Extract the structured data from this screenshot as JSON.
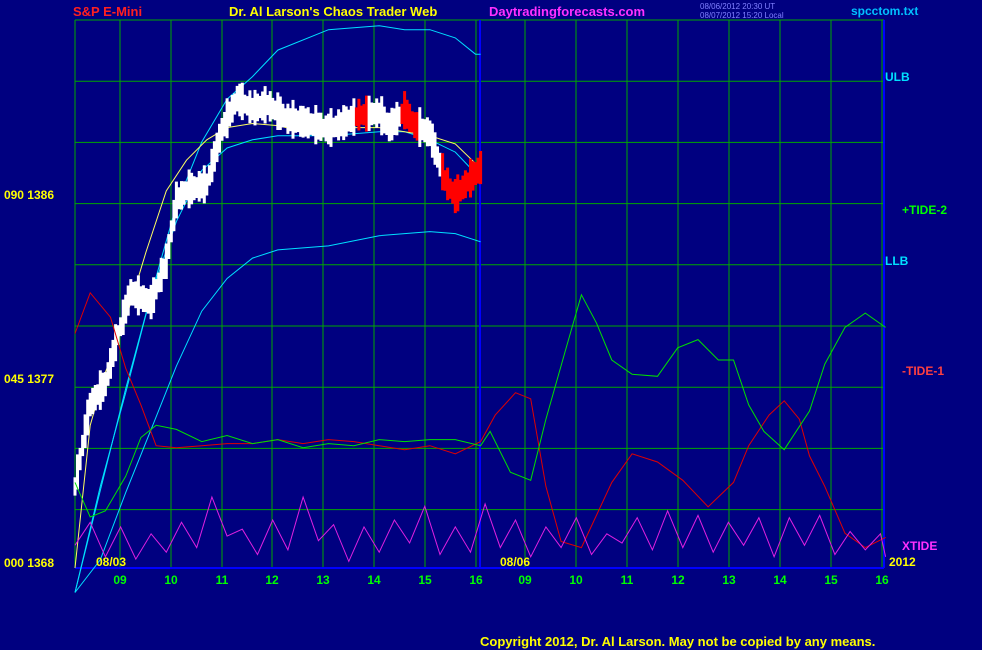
{
  "header": {
    "instrument": "S&P E-Mini",
    "title": "Dr. Al Larson's Chaos Trader Web",
    "site": "Daytradingforecasts.com",
    "stamp1": "08/06/2012 20:30 UT",
    "stamp2": "08/07/2012 15:20 Local",
    "file": "spcctom.txt"
  },
  "footer": {
    "copyright": "Copyright 2012, Dr. Al Larson. May not be copied by any means."
  },
  "colors": {
    "background": "#000080",
    "grid": "#00a800",
    "price_bars": "#ffffff",
    "down_bars": "#ff0000",
    "bands": "#00e0ff",
    "tide1": "#e00000",
    "tide2": "#00e000",
    "xtide": "#e020e0",
    "date_labels": "#ffff00",
    "hour_labels": "#00ff00"
  },
  "chart_data": {
    "type": "line",
    "title": "S&P E-Mini",
    "y_axis": {
      "labels": [
        {
          "osc": "090",
          "price": 1386
        },
        {
          "osc": "045",
          "price": 1377
        },
        {
          "osc": "000",
          "price": 1368
        }
      ],
      "ylim": [
        1368,
        1395
      ]
    },
    "x_axis": {
      "hours": [
        "09",
        "10",
        "11",
        "12",
        "13",
        "14",
        "15",
        "16",
        "09",
        "10",
        "11",
        "12",
        "13",
        "14",
        "15",
        "16"
      ],
      "dates": [
        "08/03",
        "08/06"
      ],
      "year": "2012"
    },
    "right_labels": [
      "ULB",
      "+TIDE-2",
      "LLB",
      "-TIDE-1",
      "XTIDE"
    ],
    "grid": true,
    "series": [
      {
        "name": "ULB",
        "x": [
          0.0,
          0.5,
          1.0,
          1.5,
          2.0,
          2.5,
          3.0,
          3.5,
          4.0,
          5.0,
          6.0,
          6.5,
          7.0,
          7.5,
          7.9,
          8.0
        ],
        "y": [
          1366.8,
          1371.8,
          1376.8,
          1381.4,
          1385.8,
          1388.9,
          1391.0,
          1392.1,
          1393.4,
          1394.4,
          1394.6,
          1394.4,
          1394.4,
          1394.0,
          1393.2,
          1393.2
        ]
      },
      {
        "name": "LLB",
        "x": [
          0.0,
          0.5,
          1.0,
          1.5,
          2.0,
          2.5,
          3.0,
          3.5,
          4.0,
          5.0,
          6.0,
          6.5,
          7.0,
          7.5,
          8.0
        ],
        "y": [
          1366.8,
          1368.4,
          1371.7,
          1374.8,
          1377.9,
          1380.6,
          1382.2,
          1383.2,
          1383.6,
          1383.8,
          1384.3,
          1384.4,
          1384.5,
          1384.4,
          1384.0
        ]
      },
      {
        "name": "MID",
        "x": [
          0.0,
          0.5,
          1.0,
          1.5,
          2.0,
          2.5,
          3.0,
          3.5,
          4.0,
          5.0,
          6.0,
          6.5,
          7.0,
          7.5,
          8.0
        ],
        "y": [
          1366.8,
          1372.0,
          1376.6,
          1381.4,
          1385.0,
          1387.5,
          1388.6,
          1389.0,
          1389.2,
          1389.2,
          1389.4,
          1389.4,
          1389.0,
          1388.4,
          1387.1
        ]
      },
      {
        "name": "MA",
        "x": [
          0.0,
          0.3,
          0.6,
          1.0,
          1.4,
          1.8,
          2.2,
          2.6,
          3.0,
          3.5,
          4.0,
          4.5,
          5.0,
          5.5,
          6.0,
          6.5,
          7.0,
          7.5,
          8.0
        ],
        "y": [
          1368.0,
          1375.0,
          1377.6,
          1380.2,
          1383.5,
          1386.5,
          1388.0,
          1389.0,
          1389.6,
          1389.8,
          1389.7,
          1389.4,
          1389.4,
          1389.6,
          1389.6,
          1389.4,
          1389.2,
          1388.8,
          1387.6
        ]
      },
      {
        "name": "TIDE-1",
        "x": [
          0.0,
          0.3,
          0.7,
          1.0,
          1.3,
          1.6,
          2.0,
          2.5,
          3.0,
          3.5,
          4.0,
          4.5,
          5.0,
          5.5,
          6.0,
          6.5,
          7.0,
          7.5,
          8.0,
          8.3,
          8.7,
          9.0,
          9.3,
          9.6,
          10.0,
          10.3,
          10.6,
          11.0,
          11.5,
          12.0,
          12.5,
          13.0,
          13.3,
          13.7,
          14.0,
          14.3,
          14.5,
          14.8,
          15.2,
          15.6,
          16.0
        ],
        "y": [
          115,
          135,
          123,
          98,
          80,
          60,
          59,
          60,
          61,
          61,
          63,
          61,
          63,
          62,
          60,
          58,
          60,
          56,
          62,
          75,
          86,
          83,
          40,
          13,
          10,
          26,
          42,
          56,
          52,
          43,
          30,
          42,
          60,
          75,
          82,
          73,
          55,
          40,
          17,
          10,
          15
        ]
      },
      {
        "name": "TIDE-2",
        "x": [
          0.0,
          0.3,
          0.6,
          1.0,
          1.3,
          1.6,
          2.0,
          2.5,
          3.0,
          3.5,
          4.0,
          4.5,
          5.0,
          5.5,
          6.0,
          6.5,
          7.0,
          7.5,
          8.0,
          8.2,
          8.6,
          9.0,
          9.3,
          9.7,
          10.0,
          10.3,
          10.6,
          11.0,
          11.5,
          11.9,
          12.3,
          12.7,
          13.0,
          13.3,
          13.6,
          14.0,
          14.5,
          14.8,
          15.2,
          15.6,
          16.0
        ],
        "y": [
          42,
          25,
          28,
          45,
          64,
          70,
          68,
          62,
          65,
          61,
          63,
          59,
          61,
          60,
          63,
          62,
          63,
          63,
          60,
          67,
          47,
          43,
          73,
          108,
          134,
          120,
          102,
          95,
          94,
          108,
          112,
          102,
          102,
          80,
          67,
          58,
          77,
          100,
          118,
          125,
          118
        ]
      },
      {
        "name": "XTIDE",
        "x": [
          0.0,
          0.3,
          0.6,
          0.9,
          1.2,
          1.5,
          1.8,
          2.1,
          2.4,
          2.7,
          3.0,
          3.3,
          3.6,
          3.9,
          4.2,
          4.5,
          4.8,
          5.1,
          5.4,
          5.7,
          6.0,
          6.3,
          6.6,
          6.9,
          7.2,
          7.5,
          7.8,
          8.1,
          8.4,
          8.7,
          9.0,
          9.3,
          9.6,
          9.9,
          10.2,
          10.5,
          10.8,
          11.1,
          11.4,
          11.7,
          12.0,
          12.3,
          12.6,
          12.9,
          13.2,
          13.5,
          13.8,
          14.1,
          14.4,
          14.7,
          15.0,
          15.3,
          15.6,
          15.9,
          16.0
        ],
        "y": [
          9,
          19,
          4,
          17,
          3,
          14,
          6,
          19,
          8,
          30,
          13,
          16,
          5,
          20,
          7,
          30,
          11,
          18,
          2,
          17,
          6,
          20,
          10,
          26,
          5,
          17,
          6,
          27,
          8,
          20,
          4,
          17,
          8,
          21,
          5,
          14,
          10,
          21,
          7,
          24,
          8,
          22,
          6,
          19,
          9,
          21,
          4,
          21,
          9,
          22,
          5,
          15,
          7,
          14,
          4
        ]
      }
    ]
  }
}
